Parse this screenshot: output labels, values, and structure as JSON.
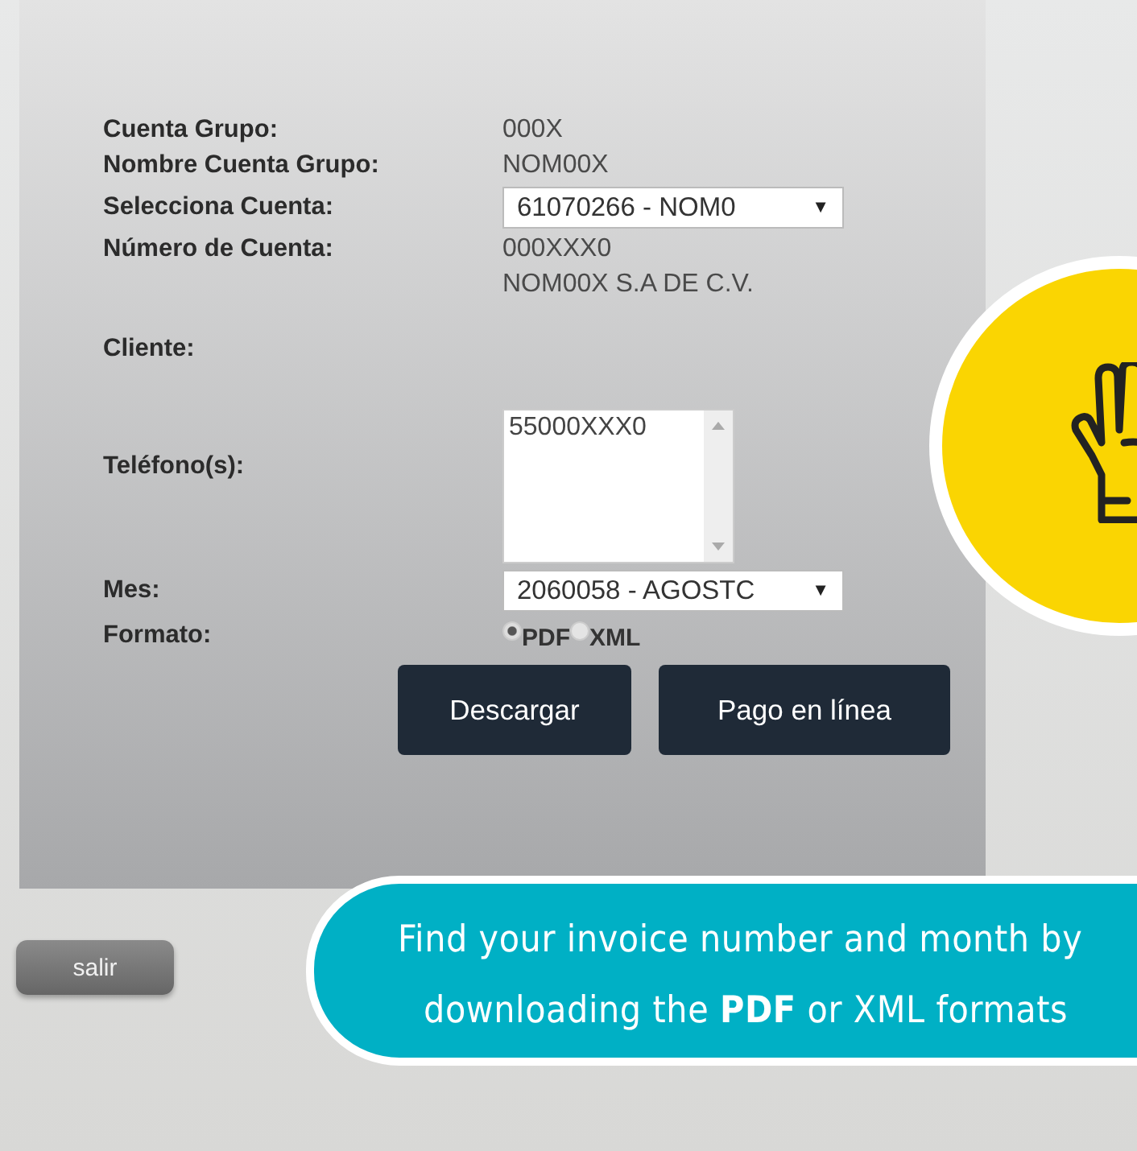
{
  "form": {
    "fields": [
      {
        "kind": "text",
        "label": "Cuenta Grupo:",
        "value": "000X"
      },
      {
        "kind": "text",
        "label": "Nombre Cuenta Grupo:",
        "value": "NOM00X"
      },
      {
        "kind": "select",
        "label": "Selecciona Cuenta:",
        "value": "61070266 - NOM0",
        "caret": "▼"
      },
      {
        "kind": "text",
        "label": "Número de Cuenta:",
        "value": "000XXX0"
      },
      {
        "kind": "tall",
        "label": "Cliente:",
        "value": "NOM00X S.A DE C.V."
      },
      {
        "kind": "listbox",
        "label": "Teléfono(s):",
        "value": "55000XXX0"
      },
      {
        "kind": "select",
        "label": "Mes:",
        "value": "2060058 - AGOSTC",
        "caret": "▼"
      },
      {
        "kind": "radio",
        "label": "Formato:",
        "options": [
          {
            "label": "PDF",
            "selected": true
          },
          {
            "label": "XML",
            "selected": false
          }
        ]
      }
    ],
    "buttons": [
      "Descargar",
      "Pago en línea"
    ]
  },
  "exit_button": "salir",
  "callout": {
    "lines": [
      "Find your invoice number and month by",
      "downloading the **PDF** or XML formats"
    ]
  }
}
